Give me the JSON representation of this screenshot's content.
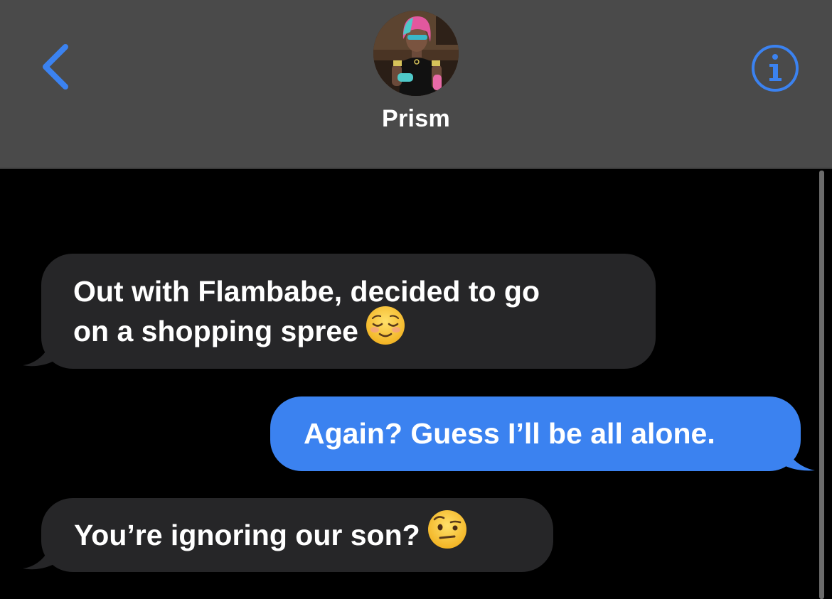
{
  "header": {
    "contact_name": "Prism",
    "back_icon": "chevron-left-icon",
    "info_icon": "info-icon",
    "accent_color": "#3b82f0"
  },
  "messages": [
    {
      "direction": "incoming",
      "lines": [
        "Out with Flambabe, decided to go",
        "on a shopping spree"
      ],
      "emoji": "relieved-face-emoji"
    },
    {
      "direction": "outgoing",
      "lines": [
        "Again? Guess I’ll be all alone."
      ]
    },
    {
      "direction": "incoming",
      "lines": [
        "You’re ignoring our son?"
      ],
      "emoji": "face-with-raised-eyebrow-emoji"
    }
  ],
  "colors": {
    "nav_bg": "#4a4a4a",
    "incoming_bubble": "#262628",
    "outgoing_bubble": "#3b82f0",
    "thread_bg": "#000000"
  }
}
